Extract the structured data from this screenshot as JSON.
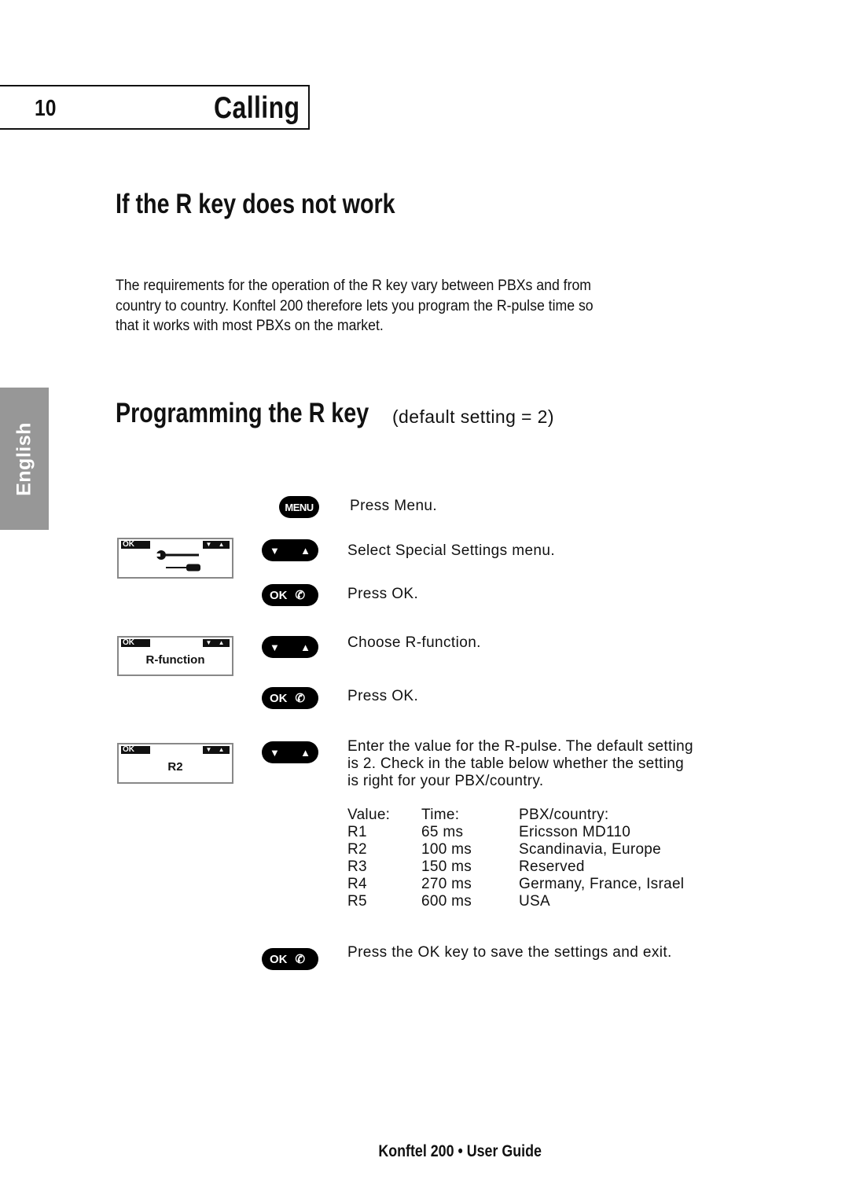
{
  "chapter": {
    "number": "10",
    "title": "Calling"
  },
  "section1": {
    "heading": "If the R key does not work",
    "body": "The requirements for the operation of the R key vary between PBXs and from country to country. Konftel 200 therefore lets you program the R-pulse time so that it works with most PBXs on the market."
  },
  "section2": {
    "heading": "Programming the R key",
    "subheading": "(default setting = 2)"
  },
  "language_tab": "English",
  "keys": {
    "menu": "MENU",
    "ok": "OK",
    "down": "▼",
    "up": "▲",
    "phone": "✆"
  },
  "displays": [
    {
      "ok": "OK",
      "arrows": "▼ ▲",
      "content": "wrench-and-screwdriver"
    },
    {
      "ok": "OK",
      "arrows": "▼ ▲",
      "content": "R-function"
    },
    {
      "ok": "OK",
      "arrows": "▼ ▲",
      "content": "R2"
    }
  ],
  "steps": [
    "Press Menu.",
    "Select Special Settings menu.",
    "Press OK.",
    "Choose R-function.",
    "Press OK.",
    "Enter the value for the R-pulse. The default setting is 2. Check in the table below whether the setting is right for your PBX/country.",
    "Press the OK key to save the settings and exit."
  ],
  "table": {
    "headers": [
      "Value:",
      "Time:",
      "PBX/country:"
    ],
    "rows": [
      [
        "R1",
        "65 ms",
        "Ericsson MD110"
      ],
      [
        "R2",
        "100 ms",
        "Scandinavia, Europe"
      ],
      [
        "R3",
        "150 ms",
        "Reserved"
      ],
      [
        "R4",
        "270 ms",
        "Germany, France, Israel"
      ],
      [
        "R5",
        "600 ms",
        "USA"
      ]
    ]
  },
  "footer": "Konftel 200 • User Guide"
}
